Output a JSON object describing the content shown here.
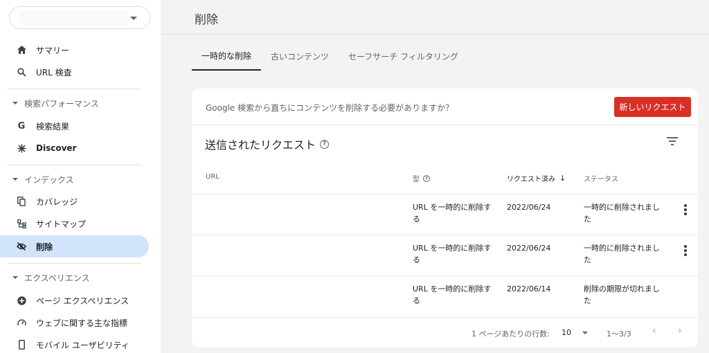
{
  "sidebar": {
    "items_top": [
      {
        "label": "サマリー",
        "icon": "home-icon"
      },
      {
        "label": "URL 検査",
        "icon": "search-icon"
      }
    ],
    "sections": [
      {
        "label": "検索パフォーマンス",
        "items": [
          {
            "label": "検索結果",
            "icon": "google-g-icon"
          },
          {
            "label": "Discover",
            "icon": "asterisk-icon"
          }
        ]
      },
      {
        "label": "インデックス",
        "items": [
          {
            "label": "カバレッジ",
            "icon": "copy-icon"
          },
          {
            "label": "サイトマップ",
            "icon": "sitemap-icon"
          },
          {
            "label": "削除",
            "icon": "eye-off-icon",
            "active": true
          }
        ]
      },
      {
        "label": "エクスペリエンス",
        "items": [
          {
            "label": "ページ エクスペリエンス",
            "icon": "add-circle-icon"
          },
          {
            "label": "ウェブに関する主な指標",
            "icon": "speed-icon"
          },
          {
            "label": "モバイル ユーザビリティ",
            "icon": "phone-icon"
          }
        ]
      }
    ]
  },
  "page": {
    "title": "削除"
  },
  "tabs": [
    {
      "label": "一時的な削除",
      "active": true
    },
    {
      "label": "古いコンテンツ"
    },
    {
      "label": "セーフサーチ フィルタリング"
    }
  ],
  "card": {
    "prompt": "Google 検索から直ちにコンテンツを削除する必要がありますか？",
    "new_request_label": "新しいリクエスト",
    "title": "送信されたリクエスト",
    "columns": {
      "url": "URL",
      "type": "型",
      "requested": "リクエスト済み",
      "status": "ステータス"
    },
    "rows": [
      {
        "url": "",
        "type_1": "URL を一時的に削除す",
        "type_2": "る",
        "date": "2022/06/24",
        "status_1": "一時的に削除されまし",
        "status_2": "た",
        "menu": true
      },
      {
        "url": "",
        "type_1": "URL を一時的に削除す",
        "type_2": "る",
        "date": "2022/06/24",
        "status_1": "一時的に削除されまし",
        "status_2": "た",
        "menu": true
      },
      {
        "url": "",
        "type_1": "URL を一時的に削除す",
        "type_2": "る",
        "date": "2022/06/14",
        "status_1": "削除の期限が切れまし",
        "status_2": "た",
        "menu": false
      }
    ],
    "footer": {
      "rows_per_page_label": "1 ページあたりの行数:",
      "rows_per_page_value": "10",
      "range": "1〜3/3"
    }
  },
  "colors": {
    "accent_red": "#d93025",
    "active_nav": "#d2e3fc"
  }
}
